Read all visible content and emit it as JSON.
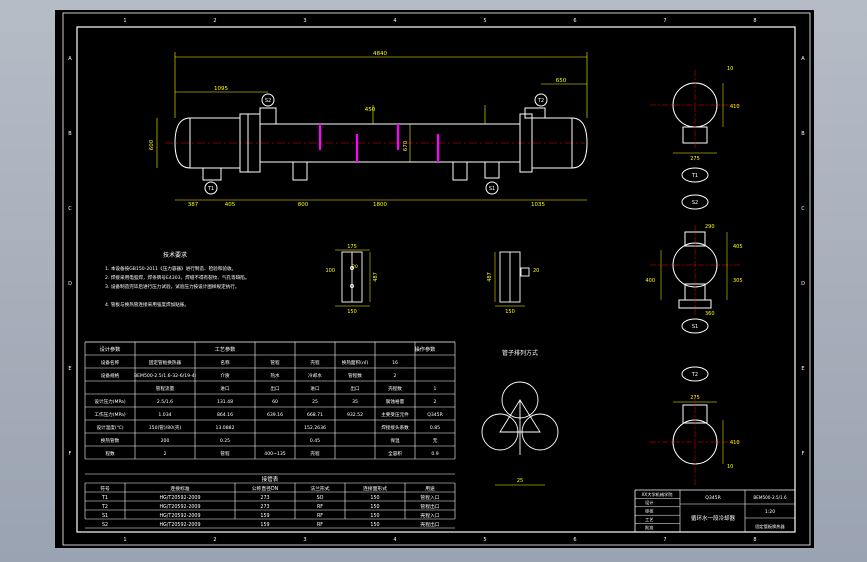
{
  "drawing": {
    "colors": {
      "background": "#000000",
      "viewport": "#a9b1bd",
      "line": "#ffffff",
      "dimension": "#ffff00",
      "text": "#ffffff",
      "center_line": "#ff0000",
      "saddle": "#ff00ff",
      "table_highlight": "#0000ff"
    },
    "border_zone_rows": [
      "A",
      "B",
      "C",
      "D",
      "E",
      "F"
    ],
    "border_zone_cols": [
      "1",
      "2",
      "3",
      "4",
      "5",
      "6",
      "7",
      "8"
    ],
    "main_view": {
      "dims_top": [
        "4840",
        "1095",
        "650"
      ],
      "dims_bottom": [
        "387",
        "405",
        "800",
        "1800",
        "1035"
      ],
      "dims_mid": [
        "450",
        "670",
        "600"
      ],
      "nozzle_labels": [
        "T1",
        "S2",
        "T2",
        "S1"
      ]
    },
    "saddle_details": {
      "left_dims": [
        "175",
        "100",
        "20",
        "487",
        "150"
      ],
      "right_dims": [
        "20",
        "487",
        "150"
      ]
    },
    "right_views": [
      {
        "label": "T1",
        "dims": [
          "10",
          "410",
          "275"
        ]
      },
      {
        "label": "S2",
        "dims": [
          "290",
          "405",
          "400",
          "305",
          "360"
        ]
      },
      {
        "label": "S1",
        "dims": []
      },
      {
        "label": "T2",
        "dims": [
          "275",
          "410",
          "10"
        ]
      }
    ],
    "notes_title": "技术要求",
    "notes": [
      "1. 本设备按GB150-2011《压力容器》进行制造、检验和验收。",
      "2. 焊接采用电弧焊，焊条牌号E4303，焊缝不得有裂纹、气孔等缺陷。",
      "3. 设备制造完毕后进行压力试验，试验压力按设计图样规定执行。",
      "",
      "4. 管板与换热管连接采用强度焊加贴胀。"
    ],
    "tube_layout": {
      "title": "管子排列方式",
      "dim": "25"
    },
    "design_table": {
      "headers": [
        "设计参数",
        "工艺参数",
        "",
        "操作参数"
      ],
      "rows": [
        [
          "设备名称",
          "固定管板换热器",
          "名称",
          "管程",
          "壳程",
          "换热面积(㎡)",
          "16"
        ],
        [
          "设备规格",
          "BEM500-2.5/1.6-32-6/19-4I",
          "介质",
          "热水",
          "冷却水",
          "管程数",
          "2"
        ],
        [
          "",
          "管程流量",
          "进口",
          "出口",
          "进口",
          "出口",
          "壳程数",
          "1"
        ],
        [
          "设计压力(MPa)",
          "2.5/1.6",
          "131.48",
          "60",
          "25",
          "35",
          "腐蚀裕量",
          "2"
        ],
        [
          "工作压力(MPa)",
          "1.034",
          "864.16",
          "639.16",
          "668.71",
          "932.52",
          "主要受压元件",
          "Q345R"
        ],
        [
          "设计温度(℃)",
          "150(管)/80(壳)",
          "13.0882",
          "",
          "152.2636",
          "",
          "焊接接头系数",
          "0.85"
        ],
        [
          "换热管数",
          "200",
          "0.25",
          "",
          "0.45",
          "",
          "保温",
          "无"
        ],
        [
          "程数",
          "2",
          "管程",
          "400~135",
          "壳程",
          "",
          "全容积",
          "0.9"
        ]
      ]
    },
    "nozzle_table": {
      "title": "接管表",
      "headers": [
        "符号",
        "连接标准",
        "公称直径DN",
        "法兰形式",
        "连接面形式",
        "用途"
      ],
      "rows": [
        [
          "T1",
          "HG/T20592-2009",
          "273",
          "SO",
          "150",
          "管程入口"
        ],
        [
          "T2",
          "HG/T20592-2009",
          "273",
          "RF",
          "150",
          "管程出口"
        ],
        [
          "S1",
          "HG/T20592-2009",
          "159",
          "RF",
          "150",
          "壳程入口"
        ],
        [
          "S2",
          "HG/T20592-2009",
          "159",
          "RF",
          "150",
          "壳程出口"
        ]
      ]
    },
    "title_block": {
      "school": "XX大学机械学院",
      "drawing_title": "循环水一段冷却器",
      "material_left": "Q345R",
      "rows_left": [
        "设计",
        "审核",
        "工艺",
        "批准"
      ],
      "drawing_no": "BEM500-2.5/1.6",
      "scale": "1:20",
      "bottom_text": "固定管板换热器"
    }
  }
}
